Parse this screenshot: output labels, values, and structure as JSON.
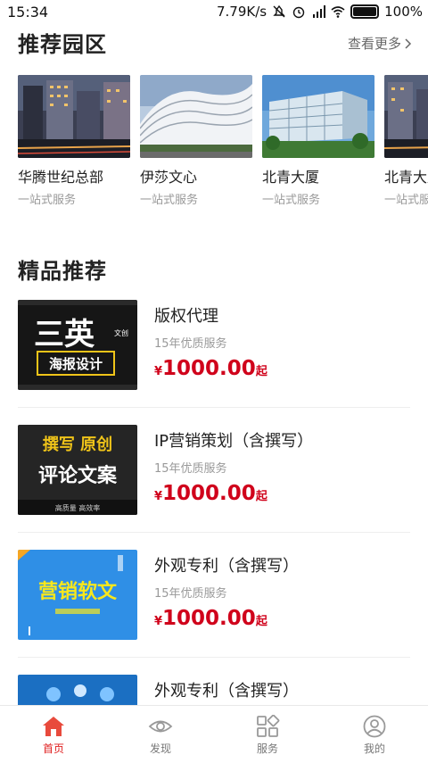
{
  "status": {
    "time": "15:34",
    "speed": "7.79K/s",
    "battery": "100%"
  },
  "parks_section": {
    "title": "推荐园区",
    "more": "查看更多"
  },
  "parks": [
    {
      "name": "华腾世纪总部",
      "sub": "一站式服务",
      "image": "city-street-night"
    },
    {
      "name": "伊莎文心",
      "sub": "一站式服务",
      "image": "curved-white-building"
    },
    {
      "name": "北青大厦",
      "sub": "一站式服务",
      "image": "glass-office-building"
    },
    {
      "name": "北青大厦",
      "sub": "一站式服务",
      "image": "city-street-night"
    }
  ],
  "products_section": {
    "title": "精品推荐"
  },
  "products": [
    {
      "title": "版权代理",
      "desc": "15年优质服务",
      "currency": "¥",
      "price": "1000.00",
      "unit": "起",
      "thumb": {
        "big": "三英",
        "tag": "文创",
        "box": "海报设计"
      }
    },
    {
      "title": "IP营销策划（含撰写）",
      "desc": "15年优质服务",
      "currency": "¥",
      "price": "1000.00",
      "unit": "起",
      "thumb": {
        "line1": "撰写 原创",
        "line2": "评论文案",
        "line3": "高质量 高效率"
      }
    },
    {
      "title": "外观专利（含撰写）",
      "desc": "15年优质服务",
      "currency": "¥",
      "price": "1000.00",
      "unit": "起",
      "thumb": {
        "text": "营销软文"
      }
    },
    {
      "title": "外观专利（含撰写）"
    }
  ],
  "tabs": [
    {
      "label": "首页",
      "icon": "home-icon",
      "active": true
    },
    {
      "label": "发现",
      "icon": "eye-icon",
      "active": false
    },
    {
      "label": "服务",
      "icon": "grid-icon",
      "active": false
    },
    {
      "label": "我的",
      "icon": "user-icon",
      "active": false
    }
  ],
  "colors": {
    "accent": "#d0021b",
    "tab_active": "#e02020"
  }
}
